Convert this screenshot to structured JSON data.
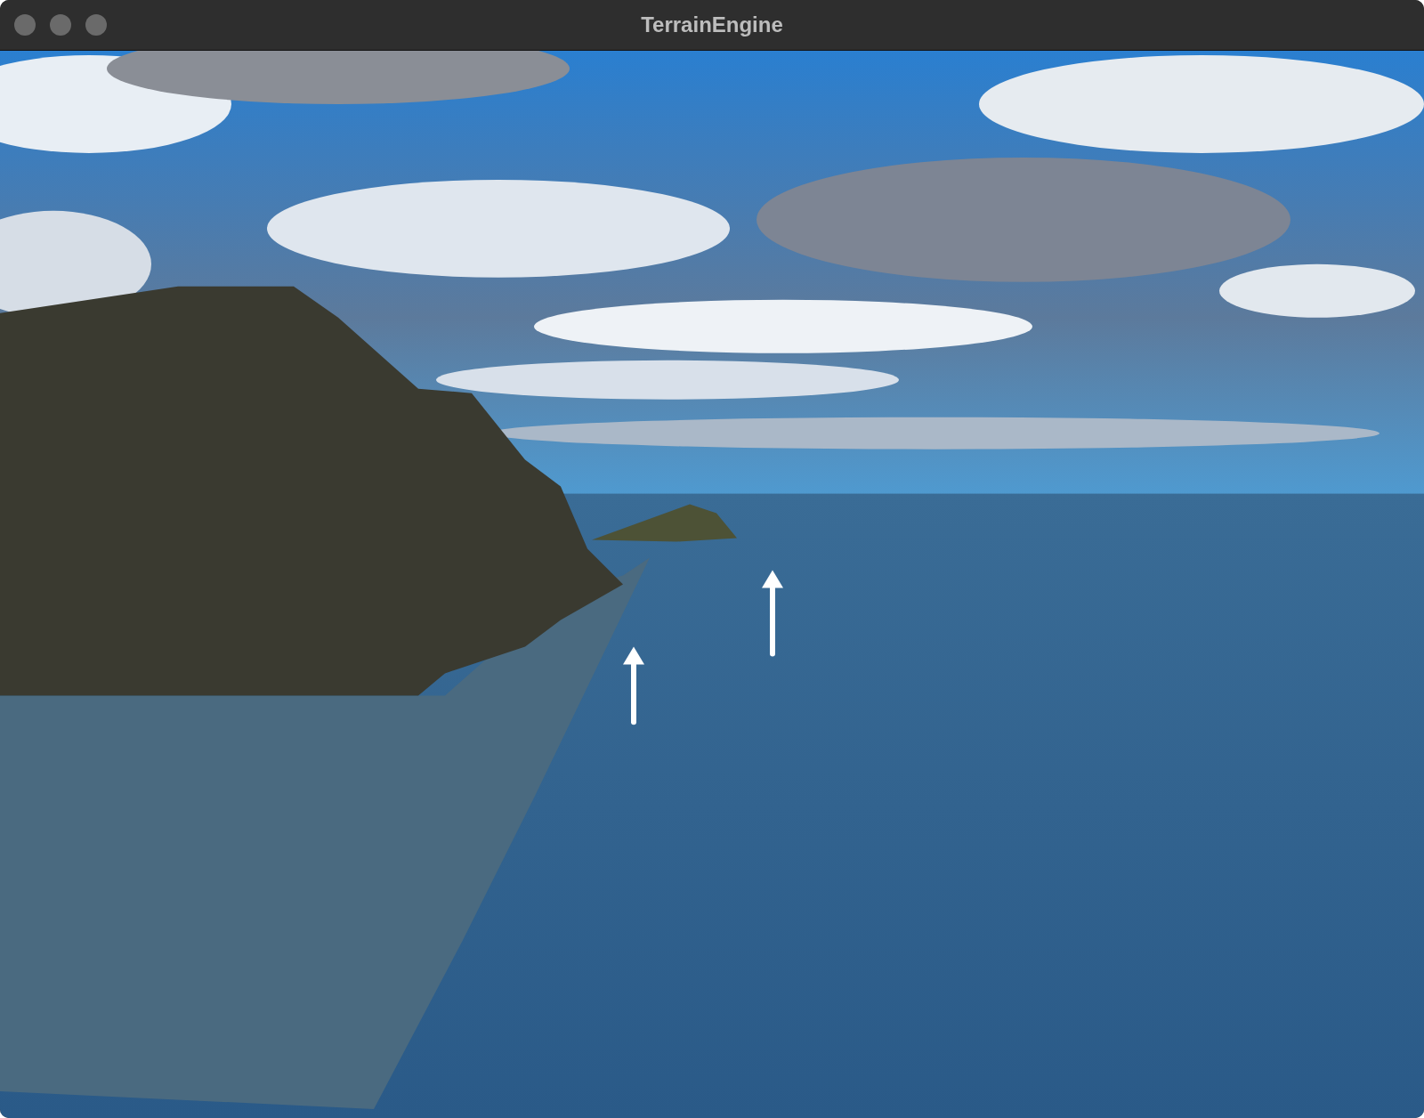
{
  "window": {
    "title": "TerrainEngine"
  }
}
